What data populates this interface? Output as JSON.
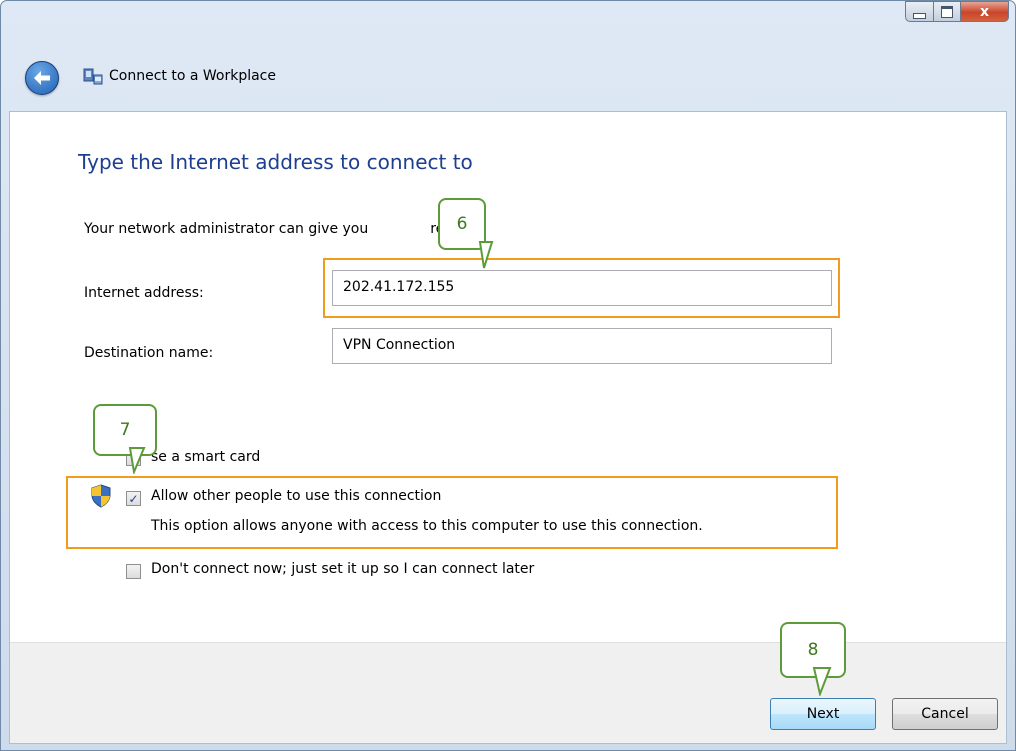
{
  "window": {
    "title": "Connect to a Workplace",
    "caption": {
      "close_glyph": "x"
    }
  },
  "content": {
    "heading": "Type the Internet address to connect to",
    "description_part1": "Your network administrator can give you",
    "description_part2": "ress.",
    "internet_address": {
      "label": "Internet address:",
      "value": "202.41.172.155"
    },
    "destination_name": {
      "label": "Destination name:",
      "value": "VPN Connection"
    },
    "options": {
      "smart_card": {
        "label": "se a smart card",
        "checked": false
      },
      "allow_others": {
        "label": "Allow other people to use this connection",
        "subtext": "This option allows anyone with access to this computer to use this connection.",
        "checked": true
      },
      "dont_connect": {
        "label": "Don't connect now; just set it up so I can connect later",
        "checked": false
      }
    }
  },
  "callouts": [
    "6",
    "7",
    "8"
  ],
  "buttons": {
    "next": "Next",
    "cancel": "Cancel"
  },
  "colors": {
    "heading": "#1e3e8f",
    "highlight": "#f29b1f",
    "callout_border": "#5d9b3a"
  }
}
